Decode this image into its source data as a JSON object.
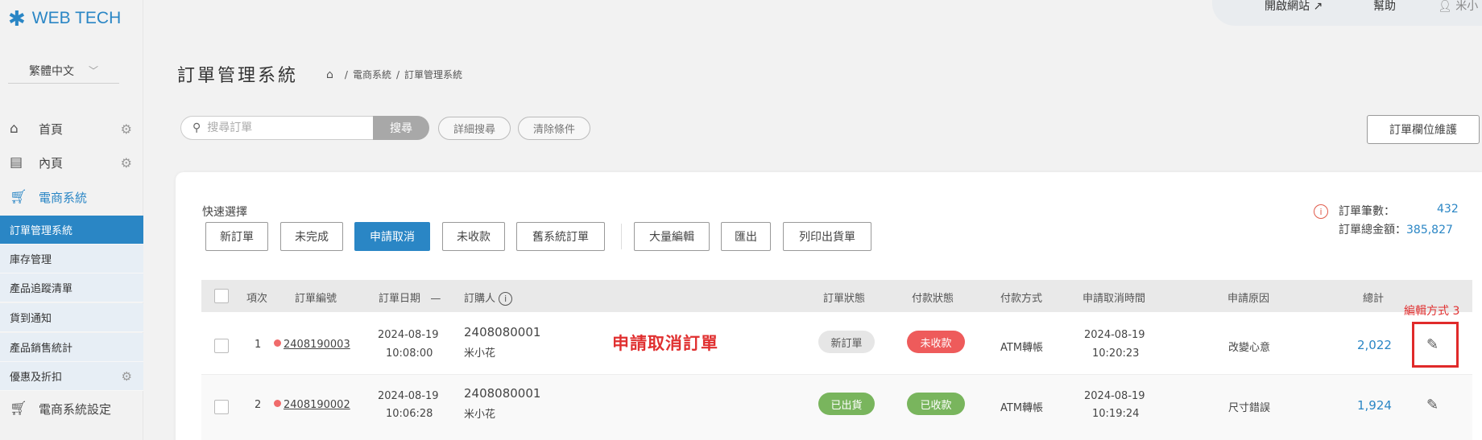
{
  "brand": {
    "logo_text": "WEB TECH",
    "logo_color": "#2a86c5"
  },
  "language": {
    "selected": "繁體中文"
  },
  "sidebar": {
    "items": [
      {
        "label": "首頁",
        "icon": "home-icon"
      },
      {
        "label": "內頁",
        "icon": "page-icon"
      },
      {
        "label": "電商系統",
        "icon": "cart-icon"
      }
    ],
    "sub_items": [
      {
        "label": "訂單管理系統"
      },
      {
        "label": "庫存管理"
      },
      {
        "label": "產品追蹤清單"
      },
      {
        "label": "貨到通知"
      },
      {
        "label": "產品銷售統計"
      },
      {
        "label": "優惠及折扣"
      }
    ],
    "settings_label": "電商系統設定"
  },
  "topbar": {
    "open_site": "開啟網站",
    "help": "幫助",
    "user": "米小"
  },
  "header": {
    "title": "訂單管理系統",
    "breadcrumb": [
      "電商系統",
      "訂單管理系統"
    ]
  },
  "search": {
    "placeholder": "搜尋訂單",
    "button": "搜尋",
    "advanced": "詳細搜尋",
    "clear": "清除條件",
    "field_maintenance": "訂單欄位維護"
  },
  "quick_select": {
    "label": "快速選擇",
    "buttons": [
      "新訂單",
      "未完成",
      "申請取消",
      "未收款",
      "舊系統訂單"
    ],
    "active": "申請取消",
    "actions": [
      "大量編輯",
      "匯出",
      "列印出貨單"
    ]
  },
  "stats": {
    "count_label": "訂單筆數：",
    "count_value": "432",
    "amount_label": "訂單總金額：",
    "amount_value": "385,827"
  },
  "table": {
    "headers": [
      "項次",
      "訂單編號",
      "訂單日期",
      "訂購人",
      "訂單狀態",
      "付款狀態",
      "付款方式",
      "申請取消時間",
      "申請原因",
      "總計"
    ],
    "date_sort_indicator": "—",
    "rows": [
      {
        "index": "1",
        "order_no": "2408190003",
        "date": "2024-08-19",
        "time": "10:08:00",
        "buyer_id": "2408080001",
        "buyer_name": "米小花",
        "order_status": "新訂單",
        "payment_status": "未收款",
        "payment_method": "ATM轉帳",
        "cancel_date": "2024-08-19",
        "cancel_time": "10:20:23",
        "reason": "改變心意",
        "total": "2,022"
      },
      {
        "index": "2",
        "order_no": "2408190002",
        "date": "2024-08-19",
        "time": "10:06:28",
        "buyer_id": "2408080001",
        "buyer_name": "米小花",
        "order_status": "已出貨",
        "payment_status": "已收款",
        "payment_method": "ATM轉帳",
        "cancel_date": "2024-08-19",
        "cancel_time": "10:19:24",
        "reason": "尺寸錯誤",
        "total": "1,924"
      }
    ]
  },
  "annotations": {
    "main": "申請取消訂單",
    "edit": "編輯方式 3"
  }
}
